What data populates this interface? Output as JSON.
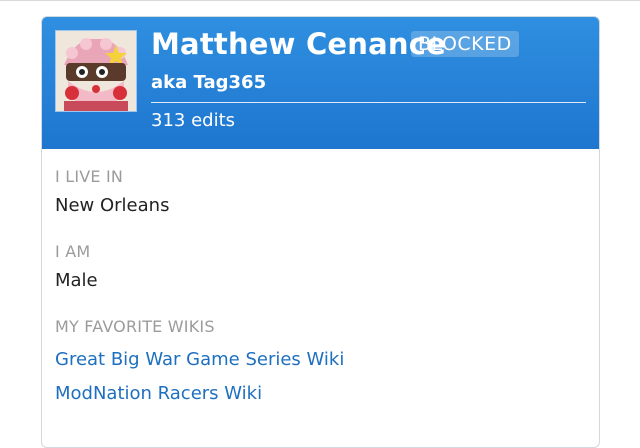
{
  "profile": {
    "name": "Matthew Cenance",
    "status_badge": "BLOCKED",
    "aka": "aka Tag365",
    "edits": "313 edits",
    "avatar_icon": "cartoon-cake-avatar-icon"
  },
  "info": {
    "live_label": "I LIVE IN",
    "live_value": "New Orleans",
    "am_label": "I AM",
    "am_value": "Male",
    "wikis_label": "MY FAVORITE WIKIS",
    "wikis": [
      "Great Big War Game Series Wiki",
      "ModNation Racers Wiki"
    ]
  },
  "colors": {
    "header": "#1e7fd6",
    "link": "#1e6fbf",
    "label": "#9b9b9b"
  }
}
